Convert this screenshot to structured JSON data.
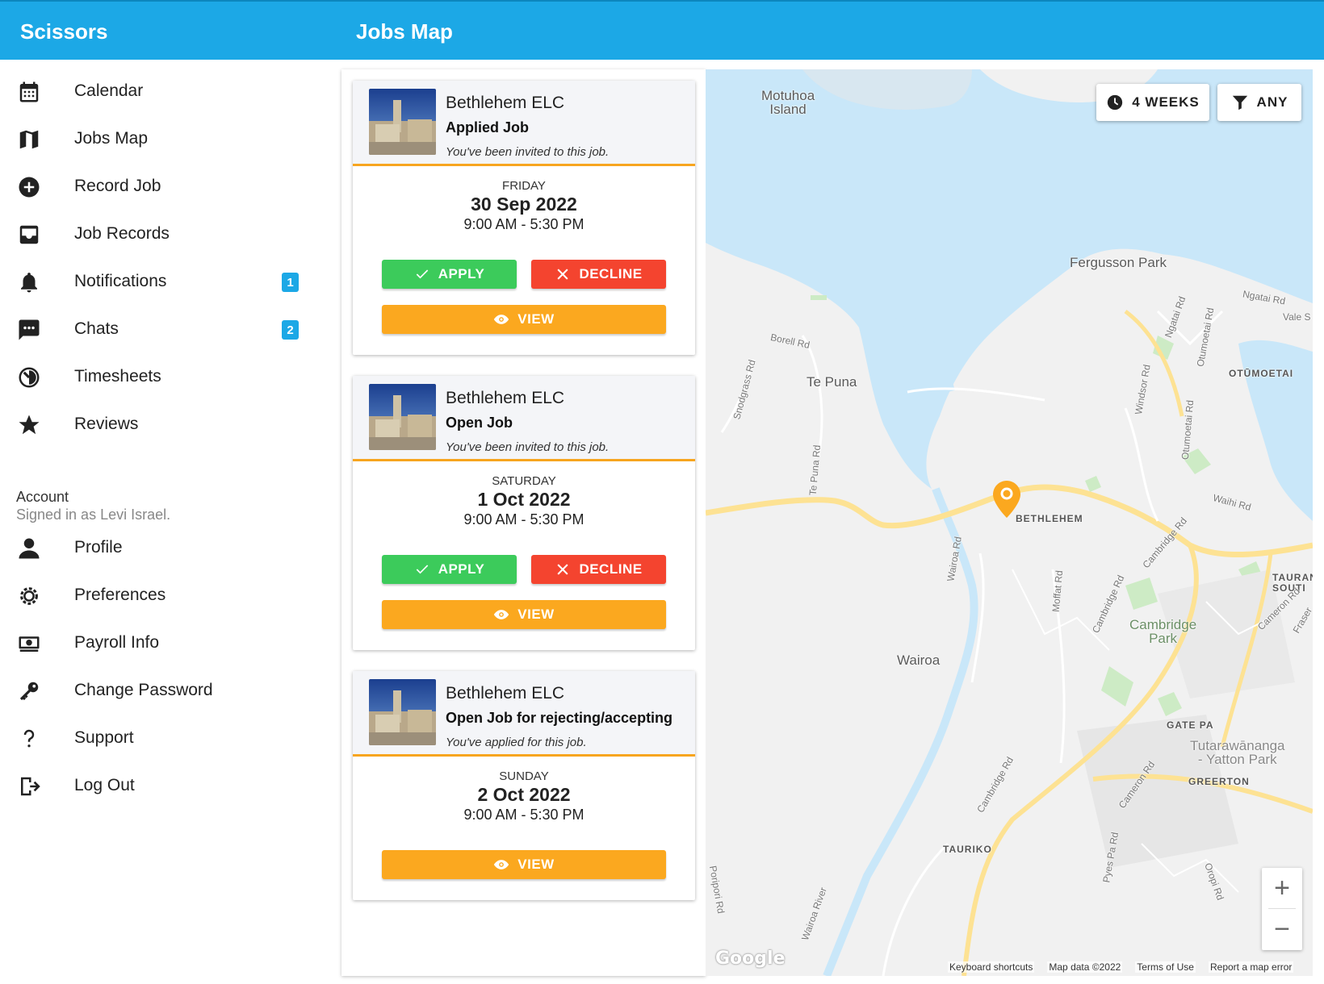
{
  "header": {
    "app_title": "Scissors",
    "page_title": "Jobs Map"
  },
  "sidebar": {
    "items": [
      {
        "label": "Calendar",
        "icon": "calendar-icon"
      },
      {
        "label": "Jobs Map",
        "icon": "map-icon"
      },
      {
        "label": "Record Job",
        "icon": "add-circle-icon"
      },
      {
        "label": "Job Records",
        "icon": "inbox-icon"
      },
      {
        "label": "Notifications",
        "icon": "bell-icon",
        "badge": "1"
      },
      {
        "label": "Chats",
        "icon": "chat-icon",
        "badge": "2"
      },
      {
        "label": "Timesheets",
        "icon": "timer-icon"
      },
      {
        "label": "Reviews",
        "icon": "star-icon"
      }
    ],
    "account": {
      "heading": "Account",
      "signed_in": "Signed in as Levi Israel."
    },
    "account_items": [
      {
        "label": "Profile",
        "icon": "person-icon"
      },
      {
        "label": "Preferences",
        "icon": "gear-icon"
      },
      {
        "label": "Payroll Info",
        "icon": "money-icon"
      },
      {
        "label": "Change Password",
        "icon": "key-icon"
      },
      {
        "label": "Support",
        "icon": "question-icon"
      },
      {
        "label": "Log Out",
        "icon": "logout-icon"
      }
    ]
  },
  "jobs": [
    {
      "name": "Bethlehem ELC",
      "status": "Applied Job",
      "note": "You've been invited to this job.",
      "day": "FRIDAY",
      "date": "30 Sep 2022",
      "time": "9:00 AM - 5:30 PM",
      "apply_label": "APPLY",
      "decline_label": "DECLINE",
      "view_label": "VIEW"
    },
    {
      "name": "Bethlehem ELC",
      "status": "Open Job",
      "note": "You've been invited to this job.",
      "day": "SATURDAY",
      "date": "1 Oct 2022",
      "time": "9:00 AM - 5:30 PM",
      "apply_label": "APPLY",
      "decline_label": "DECLINE",
      "view_label": "VIEW"
    },
    {
      "name": "Bethlehem ELC",
      "status": "Open Job for rejecting/accepting",
      "note": "You've applied for this job.",
      "day": "SUNDAY",
      "date": "2 Oct 2022",
      "time": "9:00 AM - 5:30 PM",
      "view_label": "VIEW"
    }
  ],
  "map": {
    "period_label": "4 WEEKS",
    "filter_label": "ANY",
    "zoom_in": "+",
    "zoom_out": "−",
    "logo": "Google",
    "places": {
      "motuhoa": "Motuhoa\nIsland",
      "fergusson": "Fergusson Park",
      "tepuna": "Te Puna",
      "bethlehem": "BETHLEHEM",
      "otumoetai": "OTŪMOETAI",
      "wairoa": "Wairoa",
      "cambridge_park": "Cambridge\nPark",
      "gate_pa": "GATE PA",
      "tutarawananga": "Tutarawānanga\n- Yatton Park",
      "greerton": "GREERTON",
      "tauriko": "TAURIKO",
      "tauranga_south": "TAURAN\nSOUTI"
    },
    "roads": {
      "borell": "Borell Rd",
      "snodgrass": "Snodgrass Rd",
      "te_puna_rd": "Te Puna Rd",
      "ngatai": "Ngatai Rd",
      "vale": "Vale S",
      "ngatai_v": "Ngatai Rd",
      "otumoetai_rd": "Otumoetai Rd",
      "windsor": "Windsor Rd",
      "otumoetai_rd2": "Otumoetai Rd",
      "waihi": "Waihi Rd",
      "cambridge_rd1": "Cambridge Rd",
      "wairoa_rd": "Wairoa Rd",
      "moffat": "Moffat Rd",
      "cambridge_rd2": "Cambridge Rd",
      "cameron1": "Cameron Rd",
      "fraser": "Fraser",
      "cambridge_rd3": "Cambridge Rd",
      "cameron2": "Cameron Rd",
      "pyes_pa": "Pyes Pa Rd",
      "oropi": "Oropi Rd",
      "poripori": "Poripori Rd",
      "wairoa_river": "Wairoa River"
    },
    "footer": {
      "shortcuts": "Keyboard shortcuts",
      "data": "Map data ©2022",
      "terms": "Terms of Use",
      "report": "Report a map error"
    }
  }
}
